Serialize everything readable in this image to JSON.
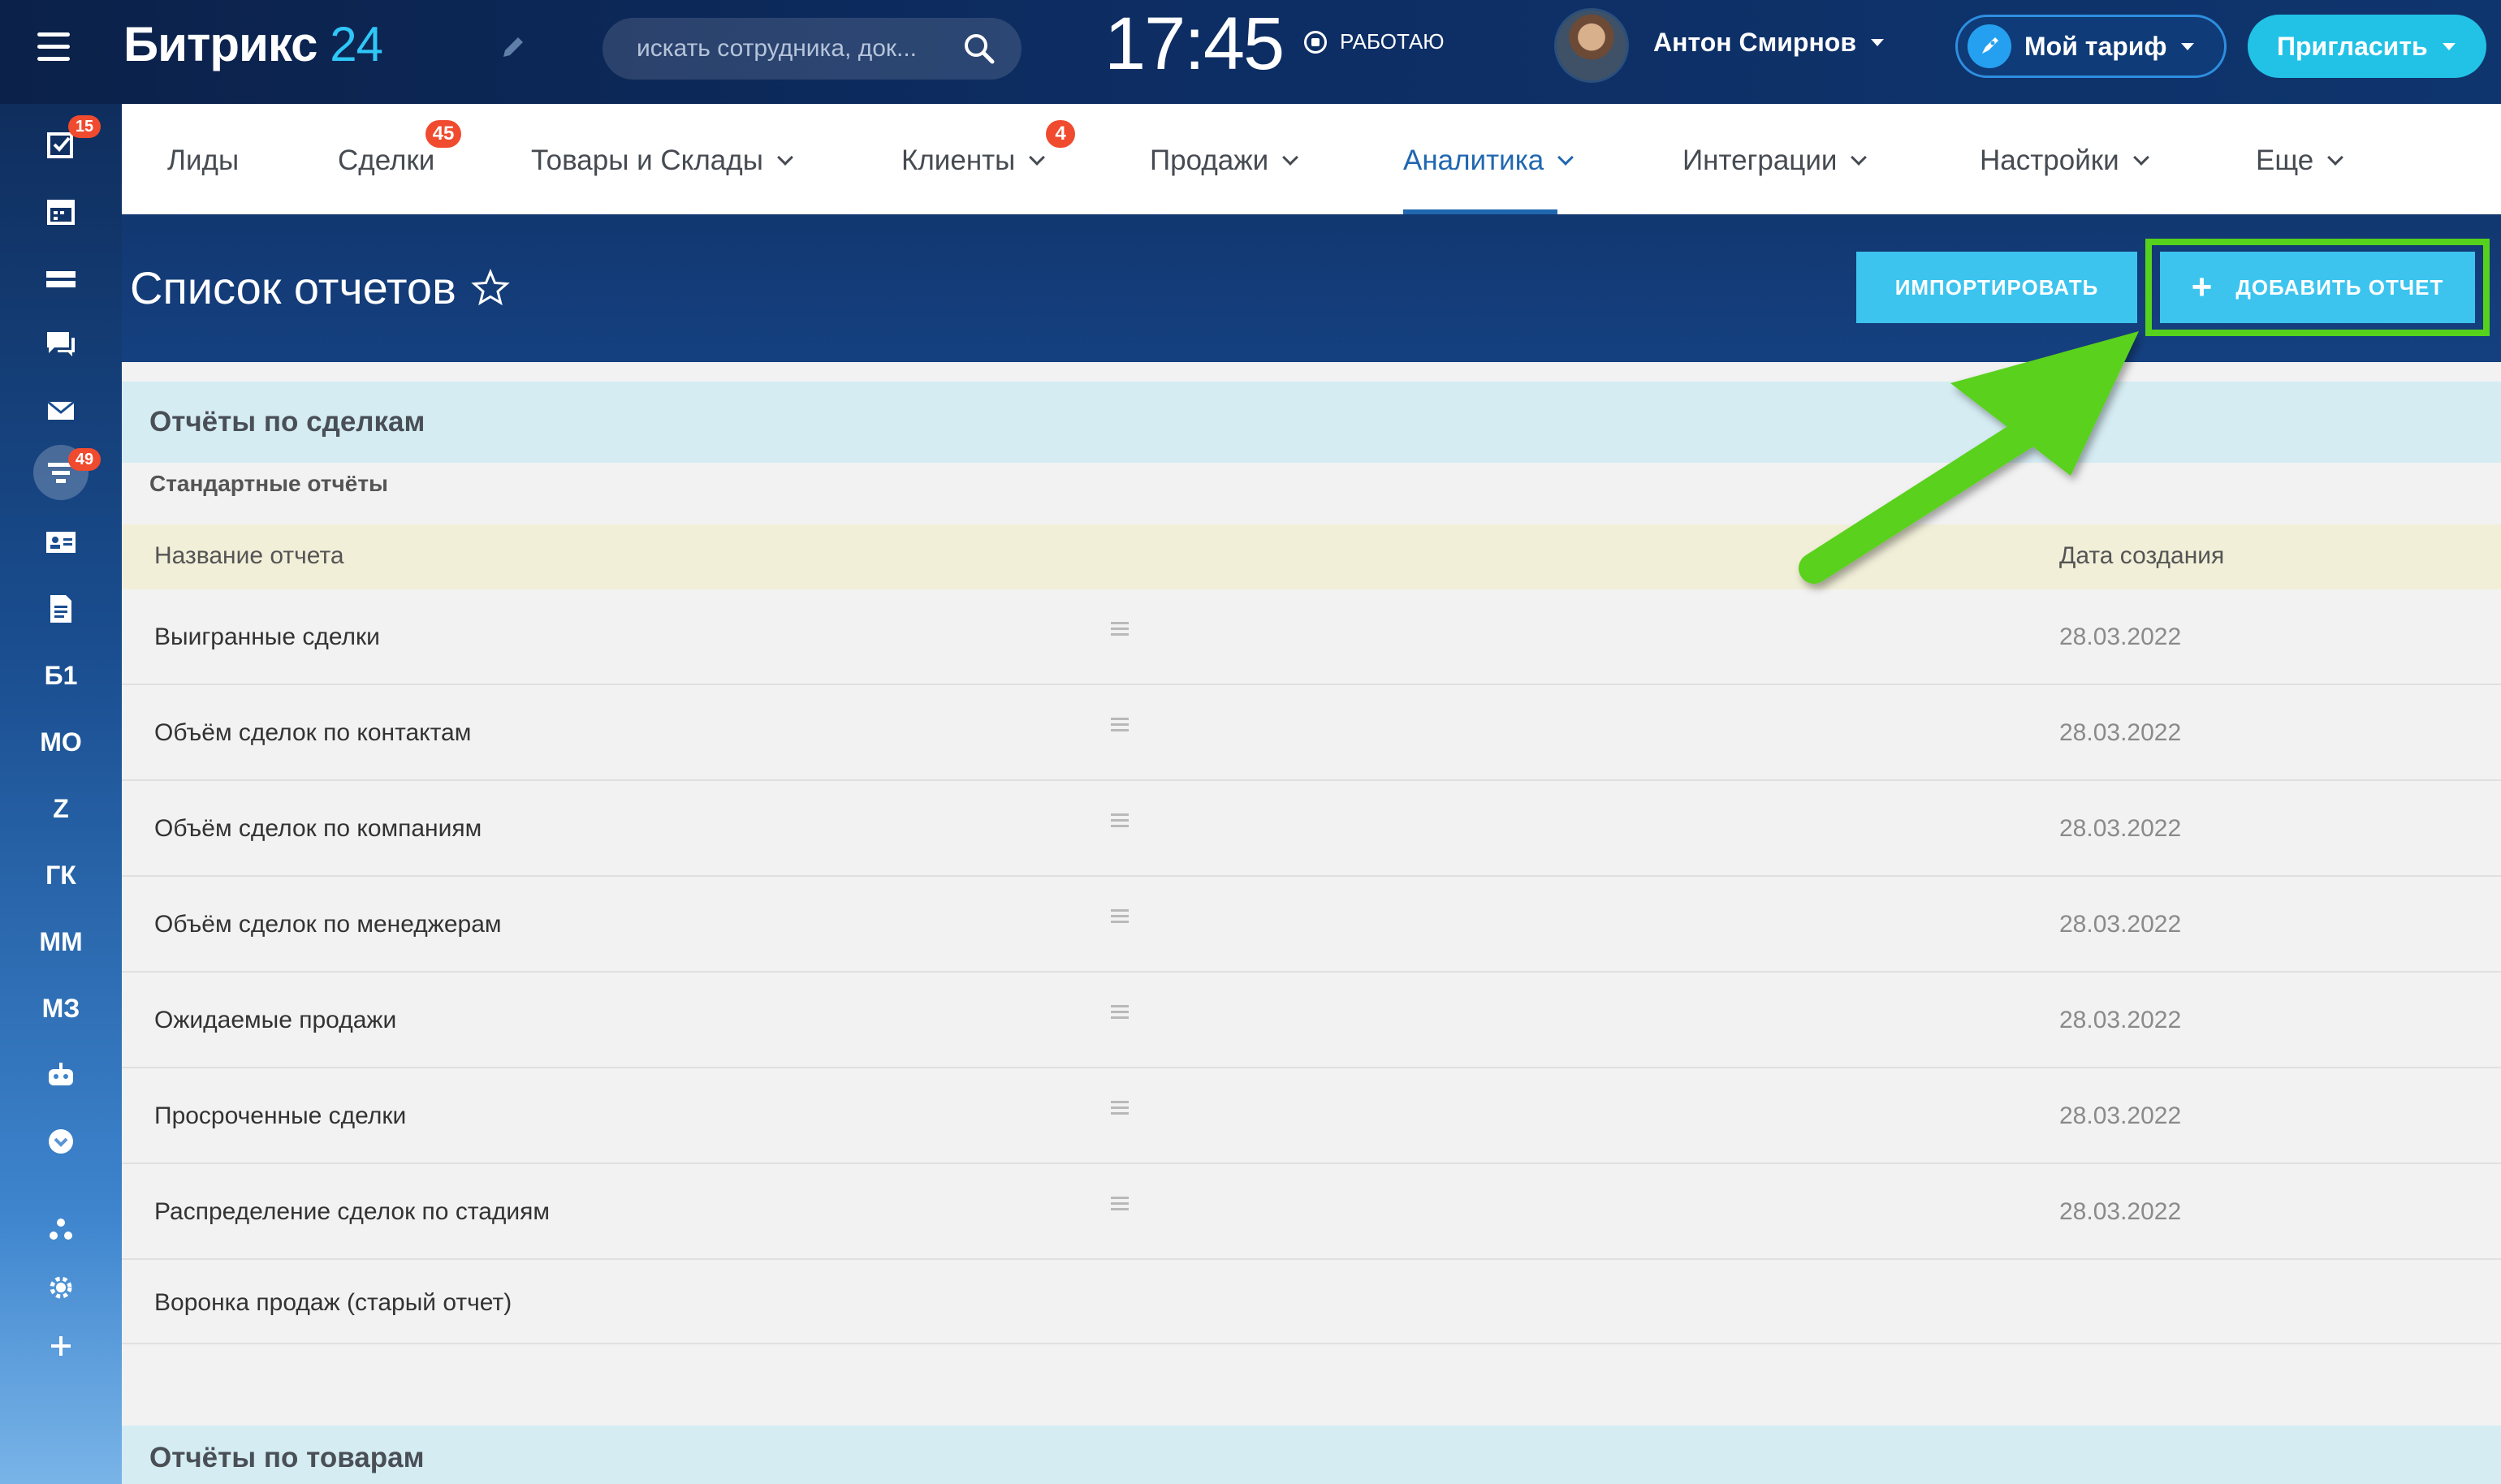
{
  "topbar": {
    "logo_text": "Битрикс",
    "logo_num": "24",
    "search_placeholder": "искать сотрудника, док...",
    "clock": "17:45",
    "work_status": "РАБОТАЮ",
    "user_name": "Антон Смирнов",
    "tariff_label": "Мой тариф",
    "invite_label": "Пригласить"
  },
  "sidebar": {
    "badges": {
      "tasks": "15",
      "crm": "49"
    },
    "text_items": [
      "Б1",
      "МО",
      "Z",
      "ГК",
      "ММ",
      "МЗ"
    ]
  },
  "nav": {
    "items": [
      {
        "label": "Лиды"
      },
      {
        "label": "Сделки",
        "badge": "45"
      },
      {
        "label": "Товары и Склады"
      },
      {
        "label": "Клиенты",
        "badge": "4"
      },
      {
        "label": "Продажи"
      },
      {
        "label": "Аналитика",
        "active": true
      },
      {
        "label": "Интеграции"
      },
      {
        "label": "Настройки"
      },
      {
        "label": "Еще"
      }
    ]
  },
  "header": {
    "title": "Список отчетов",
    "import_label": "ИМПОРТИРОВАТЬ",
    "add_label": "ДОБАВИТЬ ОТЧЕТ"
  },
  "reports": {
    "group1_title": "Отчёты по сделкам",
    "subheading": "Стандартные отчёты",
    "col_name": "Название отчета",
    "col_date": "Дата создания",
    "rows": [
      {
        "name": "Выигранные сделки",
        "date": "28.03.2022"
      },
      {
        "name": "Объём сделок по контактам",
        "date": "28.03.2022"
      },
      {
        "name": "Объём сделок по компаниям",
        "date": "28.03.2022"
      },
      {
        "name": "Объём сделок по менеджерам",
        "date": "28.03.2022"
      },
      {
        "name": "Ожидаемые продажи",
        "date": "28.03.2022"
      },
      {
        "name": "Просроченные сделки",
        "date": "28.03.2022"
      },
      {
        "name": "Распределение сделок по стадиям",
        "date": "28.03.2022"
      },
      {
        "name": "Воронка продаж (старый отчет)",
        "date": ""
      }
    ],
    "group2_title": "Отчёты по товарам"
  },
  "colors": {
    "accent": "#3cc4ef",
    "highlight": "#56d21c",
    "badge": "#f04a2f",
    "active_nav": "#2067b0"
  }
}
